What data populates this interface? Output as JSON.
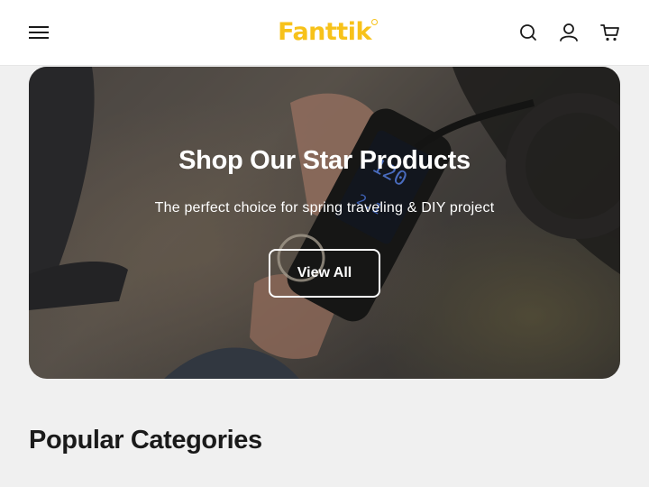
{
  "header": {
    "logo_text": "Fanttik",
    "logo_color": "#f7c21a",
    "icons": [
      "menu-icon",
      "search-icon",
      "account-icon",
      "cart-icon"
    ]
  },
  "hero": {
    "title": "Shop Our Star Products",
    "subtitle": "The perfect choice for spring traveling & DIY project",
    "button_label": "View All"
  },
  "section": {
    "title": "Popular Categories"
  }
}
